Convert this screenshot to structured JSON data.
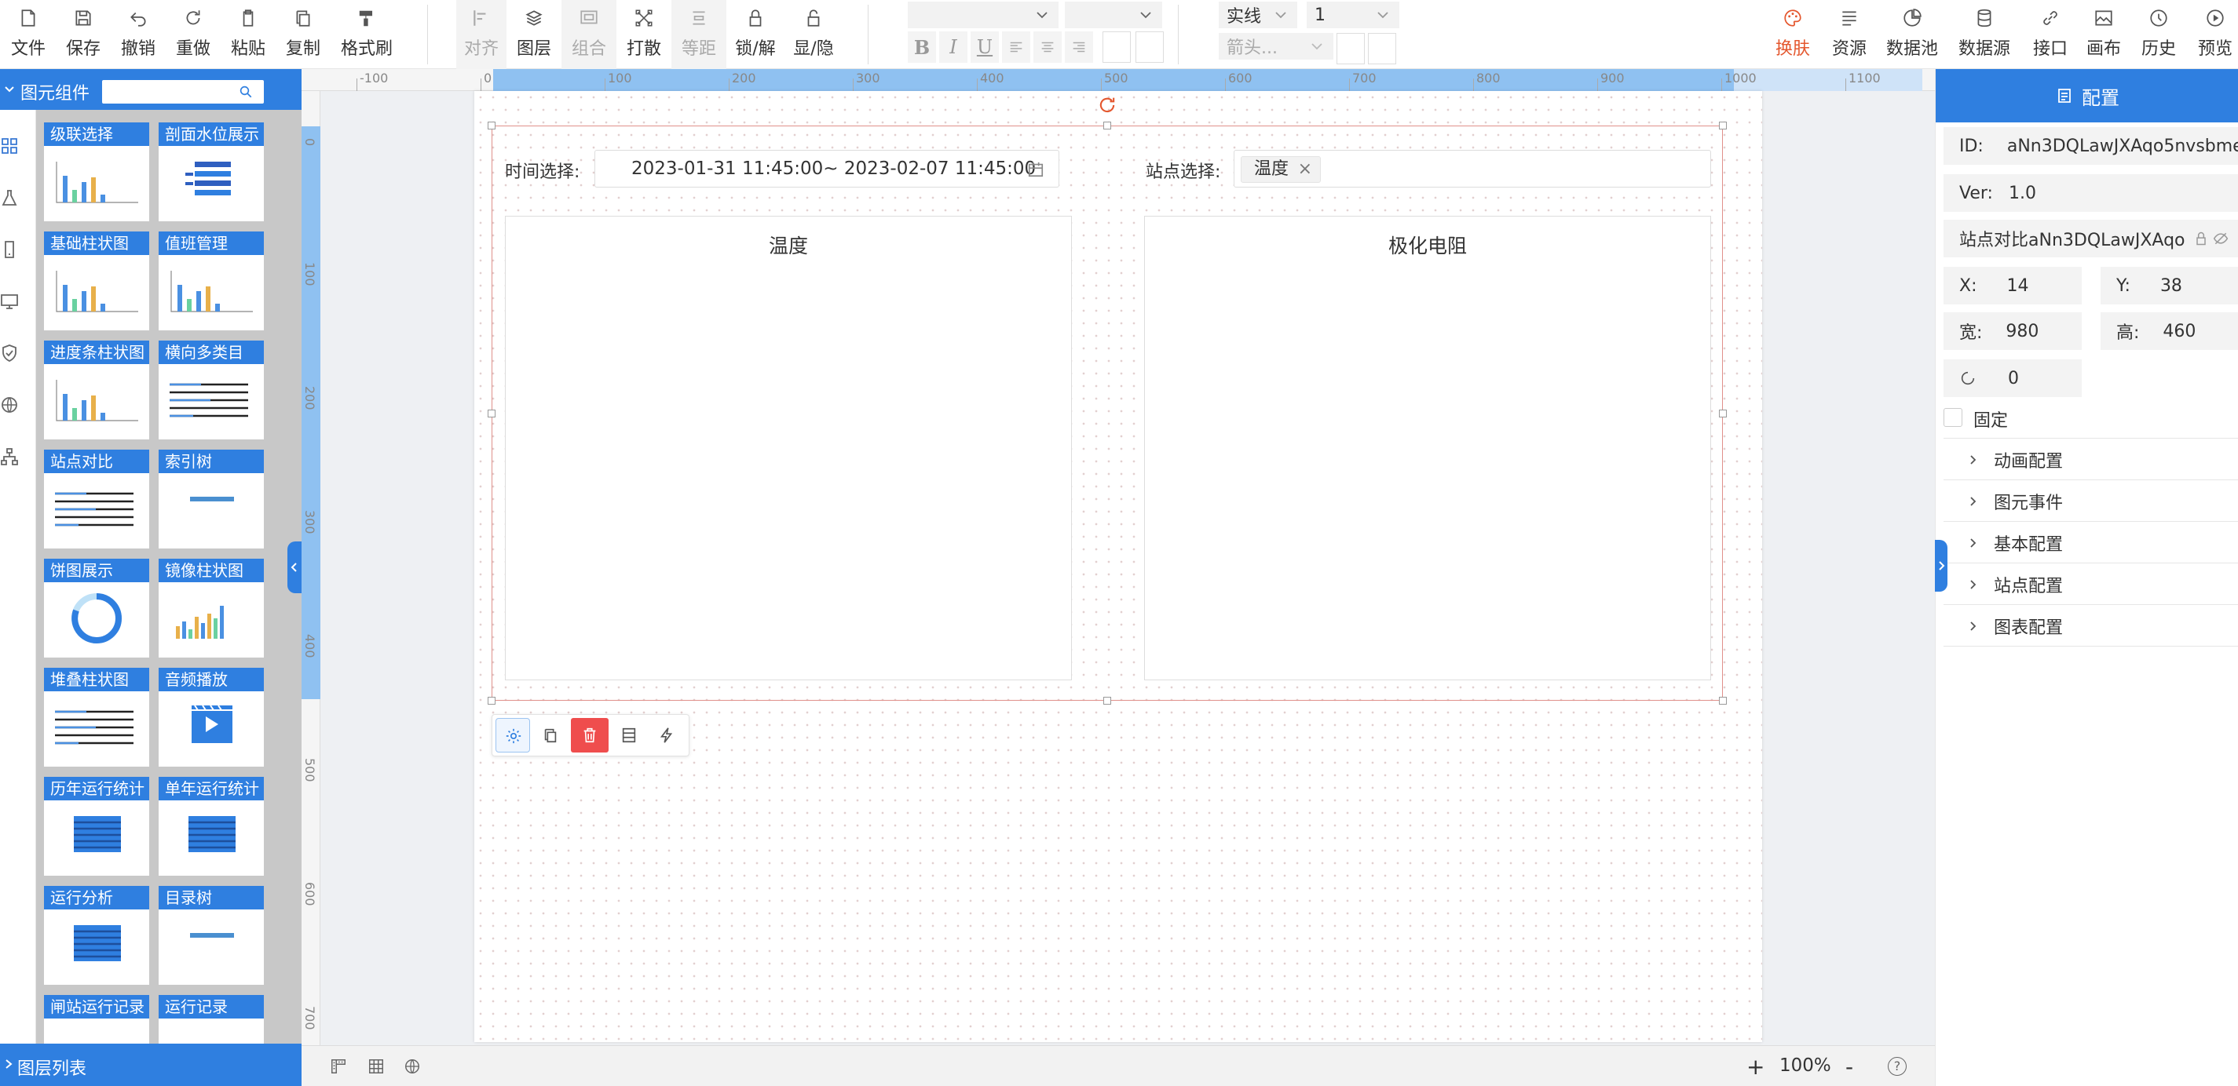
{
  "toolbar": {
    "file": "文件",
    "save": "保存",
    "undo": "撤销",
    "redo": "重做",
    "paste": "粘贴",
    "copy": "复制",
    "format_brush": "格式刷",
    "align": "对齐",
    "layer": "图层",
    "group": "组合",
    "ungroup": "打散",
    "equal_spacing": "等距",
    "lock_unlock": "锁/解",
    "show_hide": "显/隐",
    "line_style": "实线",
    "line_width": "1",
    "arrow_placeholder": "箭头...",
    "bold": "B",
    "italic": "I",
    "underline": "U",
    "skin": "换肤",
    "resources": "资源",
    "data_pool": "数据池",
    "data_source": "数据源",
    "interface": "接口",
    "canvas": "画布",
    "history": "历史",
    "preview": "预览"
  },
  "left_panel": {
    "title": "图元组件",
    "search_placeholder": "",
    "layer_list": "图层列表",
    "cards": [
      {
        "title": "级联选择",
        "preview": "bar-chart"
      },
      {
        "title": "剖面水位展示",
        "preview": "bars-horizontal"
      },
      {
        "title": "基础柱状图",
        "preview": "bar-chart"
      },
      {
        "title": "值班管理",
        "preview": "bar-chart"
      },
      {
        "title": "进度条柱状图",
        "preview": "bar-chart"
      },
      {
        "title": "横向多类目",
        "preview": "lines"
      },
      {
        "title": "站点对比",
        "preview": "lines"
      },
      {
        "title": "索引树",
        "preview": "single-line"
      },
      {
        "title": "饼图展示",
        "preview": "donut"
      },
      {
        "title": "镜像柱状图",
        "preview": "mini-bars"
      },
      {
        "title": "堆叠柱状图",
        "preview": "lines"
      },
      {
        "title": "音频播放",
        "preview": "video"
      },
      {
        "title": "历年运行统计",
        "preview": "table"
      },
      {
        "title": "单年运行统计",
        "preview": "table"
      },
      {
        "title": "运行分析",
        "preview": "table"
      },
      {
        "title": "目录树",
        "preview": "single-line"
      },
      {
        "title": "闸站运行记录",
        "preview": "none"
      },
      {
        "title": "运行记录",
        "preview": "none"
      }
    ]
  },
  "ruler": {
    "h_labels": [
      "-100",
      "0",
      "100",
      "200",
      "300",
      "400",
      "500",
      "600",
      "700",
      "800",
      "900",
      "1000",
      "1100"
    ],
    "v_labels": [
      "0",
      "100",
      "200",
      "300",
      "400",
      "500",
      "600",
      "700"
    ]
  },
  "widget": {
    "time_label": "时间选择:",
    "time_value": "2023-01-31 11:45:00~ 2023-02-07 11:45:00",
    "station_label": "站点选择:",
    "station_tag": "温度",
    "station_tag_close": "×",
    "chart_left_title": "温度",
    "chart_right_title": "极化电阻"
  },
  "config": {
    "title": "配置",
    "id_label": "ID:",
    "id_value": "aNn3DQLawJXAqo5nvsbme",
    "ver_label": "Ver:",
    "ver_value": "1.0",
    "name_value": "站点对比aNn3DQLawJXAqo",
    "x_label": "X:",
    "x_value": "14",
    "y_label": "Y:",
    "y_value": "38",
    "w_label": "宽:",
    "w_value": "980",
    "h_label": "高:",
    "h_value": "460",
    "rotate_value": "0",
    "fixed_label": "固定",
    "sections": [
      "动画配置",
      "图元事件",
      "基本配置",
      "站点配置",
      "图表配置"
    ]
  },
  "bottom": {
    "zoom_in": "+",
    "zoom": "100%",
    "zoom_out": "-",
    "help": "?"
  },
  "colors": {
    "primary": "#2f7fe0",
    "accent": "#e4572e",
    "selection": "#e0908a",
    "delete": "#ef4d4d"
  }
}
